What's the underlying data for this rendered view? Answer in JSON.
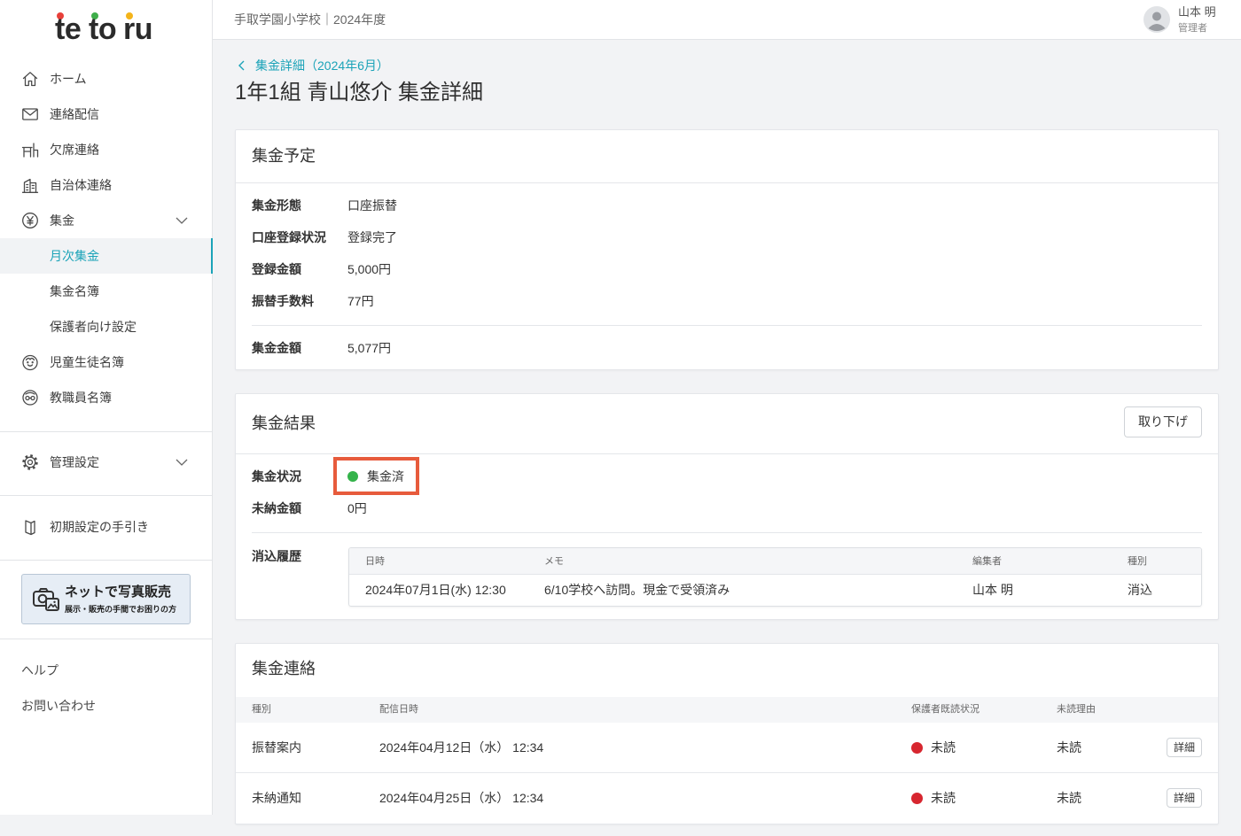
{
  "logo": {
    "parts": [
      "te",
      "to",
      "ru"
    ],
    "dot_colors": [
      "#e8403a",
      "#3fae4a",
      "#f4b41a"
    ]
  },
  "colors": {
    "accent": "#1ba3b8",
    "paid": "#34b34a",
    "unread": "#d7262f",
    "highlight": "#e75b3c"
  },
  "header": {
    "school_year": "手取学園小学校｜2024年度",
    "user_name": "山本 明",
    "user_role": "管理者",
    "avatar_icon": "user-avatar-icon"
  },
  "sidebar": {
    "home": {
      "label": "ホーム",
      "icon": "home-icon"
    },
    "messages": {
      "label": "連絡配信",
      "icon": "mail-icon"
    },
    "absence": {
      "label": "欠席連絡",
      "icon": "desk-icon"
    },
    "municipality": {
      "label": "自治体連絡",
      "icon": "building-icon"
    },
    "collection": {
      "label": "集金",
      "icon": "yen-icon",
      "expanded": true
    },
    "collection_sub": [
      {
        "label": "月次集金",
        "active": true
      },
      {
        "label": "集金名簿"
      },
      {
        "label": "保護者向け設定"
      }
    ],
    "students": {
      "label": "児童生徒名簿",
      "icon": "child-icon"
    },
    "staff": {
      "label": "教職員名簿",
      "icon": "teacher-icon"
    },
    "admin": {
      "label": "管理設定",
      "icon": "gear-icon"
    },
    "guide": {
      "label": "初期設定の手引き",
      "icon": "book-icon"
    },
    "banner": {
      "title": "ネットで写真販売",
      "subtitle": "展示・販売の手間でお困りの方",
      "icon": "photo-camera-icon"
    },
    "help": "ヘルプ",
    "contact": "お問い合わせ"
  },
  "breadcrumb": {
    "label": "集金詳細（2024年6月）"
  },
  "page_title": "1年1組 青山悠介 集金詳細",
  "schedule": {
    "title": "集金予定",
    "rows": [
      {
        "label": "集金形態",
        "value": "口座振替"
      },
      {
        "label": "口座登録状況",
        "value": "登録完了"
      },
      {
        "label": "登録金額",
        "value": "5,000円"
      },
      {
        "label": "振替手数料",
        "value": "77円"
      }
    ],
    "total": {
      "label": "集金金額",
      "value": "5,077円"
    }
  },
  "result": {
    "title": "集金結果",
    "withdraw_button": "取り下げ",
    "status": {
      "label": "集金状況",
      "value": "集金済"
    },
    "unpaid": {
      "label": "未納金額",
      "value": "0円"
    },
    "history": {
      "label": "消込履歴",
      "columns": [
        "日時",
        "メモ",
        "編集者",
        "種別"
      ],
      "rows": [
        {
          "datetime": "2024年07月1日(水) 12:30",
          "memo": "6/10学校へ訪問。現金で受領済み",
          "editor": "山本 明",
          "type": "消込"
        }
      ]
    }
  },
  "notices": {
    "title": "集金連絡",
    "columns": [
      "種別",
      "配信日時",
      "保護者既読状況",
      "未読理由"
    ],
    "rows": [
      {
        "type": "振替案内",
        "datetime": "2024年04月12日（水） 12:34",
        "read_status": "未読",
        "unread_reason": "未読",
        "detail_button": "詳細"
      },
      {
        "type": "未納通知",
        "datetime": "2024年04月25日（水） 12:34",
        "read_status": "未読",
        "unread_reason": "未読",
        "detail_button": "詳細"
      }
    ]
  }
}
